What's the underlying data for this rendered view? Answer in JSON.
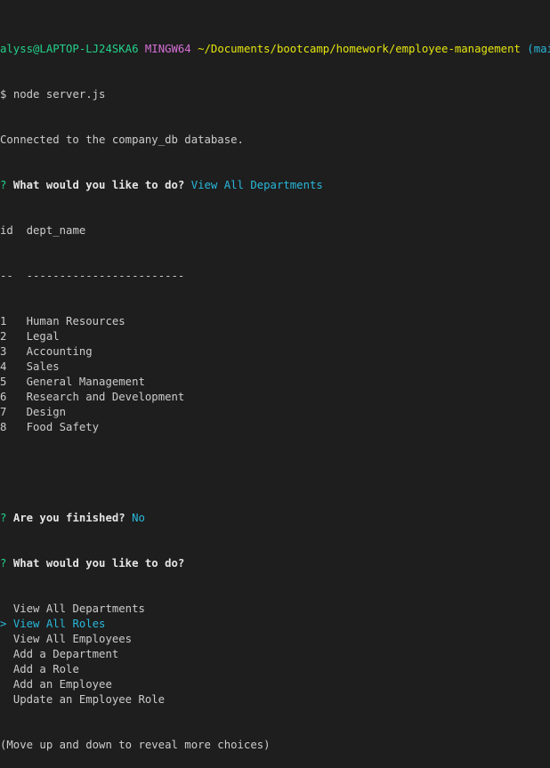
{
  "prompt": {
    "user_host": "alyss@LAPTOP-LJ24SKA6",
    "shell": "MINGW64",
    "path": "~/Documents/bootcamp/homework/employee-management",
    "branch": "(main)",
    "symbol": "$",
    "command": "node server.js"
  },
  "connected_message": "Connected to the company_db database.",
  "first_question": {
    "marker": "?",
    "text": "What would you like to do?",
    "answer": "View All Departments"
  },
  "table": {
    "header_id": "id",
    "header_name": "dept_name",
    "sep_id": "--",
    "sep_name": "------------------------",
    "rows": [
      {
        "id": "1",
        "name": "Human Resources"
      },
      {
        "id": "2",
        "name": "Legal"
      },
      {
        "id": "3",
        "name": "Accounting"
      },
      {
        "id": "4",
        "name": "Sales"
      },
      {
        "id": "5",
        "name": "General Management"
      },
      {
        "id": "6",
        "name": "Research and Development"
      },
      {
        "id": "7",
        "name": "Design"
      },
      {
        "id": "8",
        "name": "Food Safety"
      }
    ]
  },
  "finished_question": {
    "marker": "?",
    "text": "Are you finished?",
    "answer": "No"
  },
  "second_question": {
    "marker": "?",
    "text": "What would you like to do?"
  },
  "menu": {
    "pointer": ">",
    "selected_index": 1,
    "choices": [
      "View All Departments",
      "View All Roles",
      "View All Employees",
      "Add a Department",
      "Add a Role",
      "Add an Employee",
      "Update an Employee Role"
    ]
  },
  "hint": "(Move up and down to reveal more choices)",
  "colors": {
    "background": "#1e1e1e",
    "text": "#cccccc",
    "green": "#23d18b",
    "magenta": "#d670d6",
    "yellow": "#e5e510",
    "cyan": "#29b8db"
  }
}
